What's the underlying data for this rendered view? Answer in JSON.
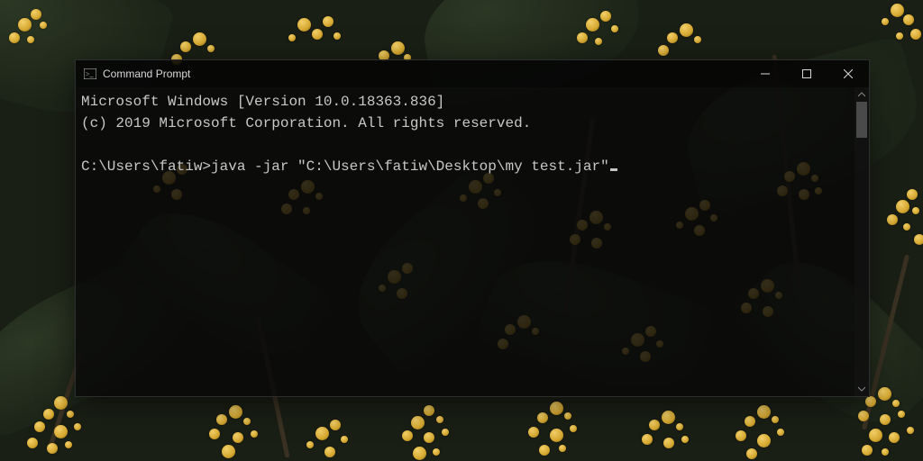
{
  "window": {
    "title": "Command Prompt",
    "icon_name": "cmd-icon"
  },
  "terminal": {
    "line1": "Microsoft Windows [Version 10.0.18363.836]",
    "line2": "(c) 2019 Microsoft Corporation. All rights reserved.",
    "prompt": "C:\\Users\\fatiw>",
    "command": "java -jar \"C:\\Users\\fatiw\\Desktop\\my test.jar\""
  }
}
